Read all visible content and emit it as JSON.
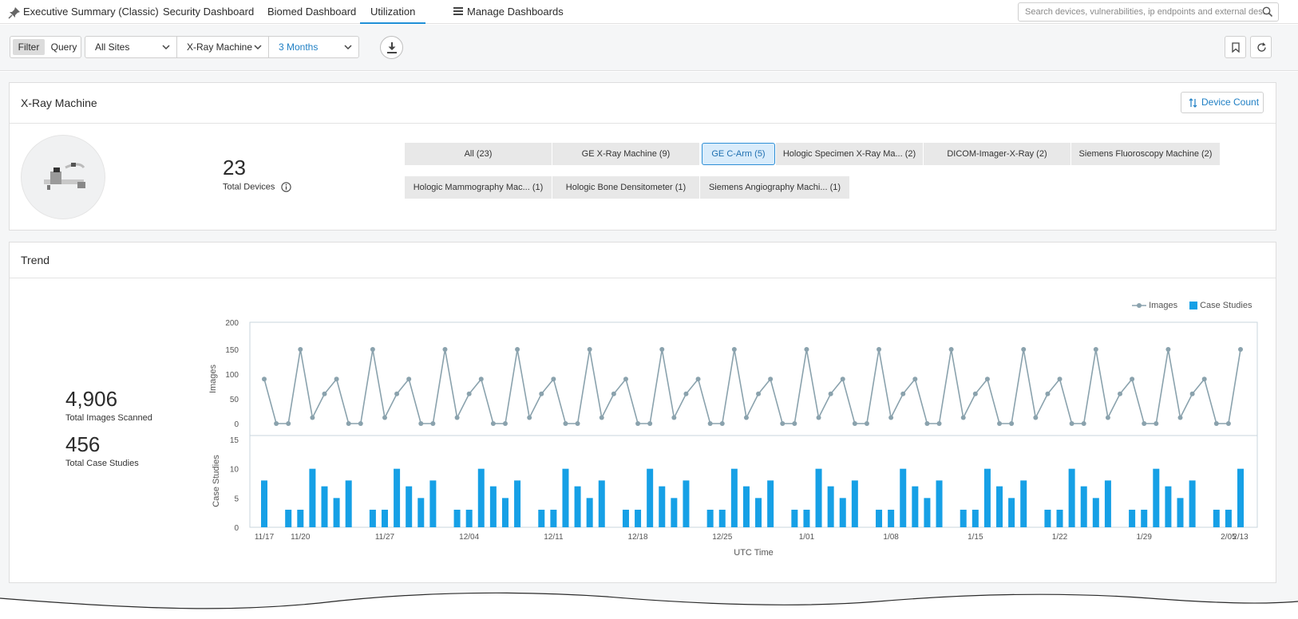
{
  "nav": {
    "tabs": [
      {
        "label": "Executive Summary (Classic)"
      },
      {
        "label": "Security Dashboard"
      },
      {
        "label": "Biomed Dashboard"
      },
      {
        "label": "Utilization"
      },
      {
        "label": "Manage Dashboards"
      }
    ],
    "active_tab": "Utilization",
    "search_placeholder": "Search devices, vulnerabilities, ip endpoints and external des..."
  },
  "filterbar": {
    "filter_label": "Filter",
    "query_label": "Query",
    "site_select": "All Sites",
    "device_select": "X-Ray Machine",
    "range_select": "3 Months",
    "accent_color": "#1f7fc4"
  },
  "device_card": {
    "title": "X-Ray Machine",
    "device_count_button": "Device Count",
    "total_devices": "23",
    "total_devices_label": "Total Devices",
    "chips": [
      {
        "label": "All (23)"
      },
      {
        "label": "GE X-Ray Machine (9)"
      },
      {
        "label": "GE C-Arm (5)",
        "selected": true
      },
      {
        "label": "Hologic Specimen X-Ray Ma...  (2)"
      },
      {
        "label": "DICOM-Imager-X-Ray (2)"
      },
      {
        "label": "Siemens Fluoroscopy Machine (2)"
      },
      {
        "label": "Hologic Mammography Mac...  (1)"
      },
      {
        "label": "Hologic Bone Densitometer (1)"
      },
      {
        "label": "Siemens Angiography Machi...  (1)"
      }
    ]
  },
  "trend_card": {
    "title": "Trend",
    "total_images": "4,906",
    "total_images_label": "Total Images Scanned",
    "total_cases": "456",
    "total_cases_label": "Total Case Studies"
  },
  "chart_data": {
    "type": "line",
    "xlabel": "UTC Time",
    "x_ticks": [
      "11/17",
      "11/20",
      "11/27",
      "12/04",
      "12/11",
      "12/18",
      "12/25",
      "1/01",
      "1/08",
      "1/15",
      "1/22",
      "1/29",
      "2/05",
      "2/13"
    ],
    "legend": [
      "Images",
      "Case Studies"
    ],
    "legend_placement": "top-right",
    "grid": false,
    "series_colors": {
      "Images": "#8aa2ad",
      "Case Studies": "#16a0e6"
    },
    "panels": [
      {
        "type": "line",
        "ylabel": "Images",
        "ylim": [
          0,
          200
        ],
        "yticks": [
          0,
          50,
          100,
          150,
          200
        ],
        "series": [
          {
            "name": "Images",
            "values": [
              90,
              0,
              0,
              150,
              12,
              60,
              90,
              0,
              0,
              150,
              12,
              60,
              90,
              0,
              0,
              150,
              12,
              60,
              90,
              0,
              0,
              150,
              12,
              60,
              90,
              0,
              0,
              150,
              12,
              60,
              90,
              0,
              0,
              150,
              12,
              60,
              90,
              0,
              0,
              150,
              12,
              60,
              90,
              0,
              0,
              150,
              12,
              60,
              90,
              0,
              0,
              150,
              12,
              60,
              90,
              0,
              0,
              150,
              12,
              60,
              90,
              0,
              0,
              150,
              12,
              60,
              90,
              0,
              0,
              150,
              12,
              60,
              90,
              0,
              0,
              150,
              12,
              60,
              90,
              0,
              0,
              150
            ]
          }
        ]
      },
      {
        "type": "bar",
        "ylabel": "Case Studies",
        "ylim": [
          0,
          15
        ],
        "yticks": [
          0,
          5,
          10,
          15
        ],
        "series": [
          {
            "name": "Case Studies",
            "values": [
              8,
              0,
              3,
              3,
              10,
              7,
              5,
              8,
              0,
              3,
              3,
              10,
              7,
              5,
              8,
              0,
              3,
              3,
              10,
              7,
              5,
              8,
              0,
              3,
              3,
              10,
              7,
              5,
              8,
              0,
              3,
              3,
              10,
              7,
              5,
              8,
              0,
              3,
              3,
              10,
              7,
              5,
              8,
              0,
              3,
              3,
              10,
              7,
              5,
              8,
              0,
              3,
              3,
              10,
              7,
              5,
              8,
              0,
              3,
              3,
              10,
              7,
              5,
              8,
              0,
              3,
              3,
              10,
              7,
              5,
              8,
              0,
              3,
              3,
              10,
              7,
              5,
              8,
              0,
              3,
              3,
              10
            ]
          }
        ]
      }
    ]
  }
}
